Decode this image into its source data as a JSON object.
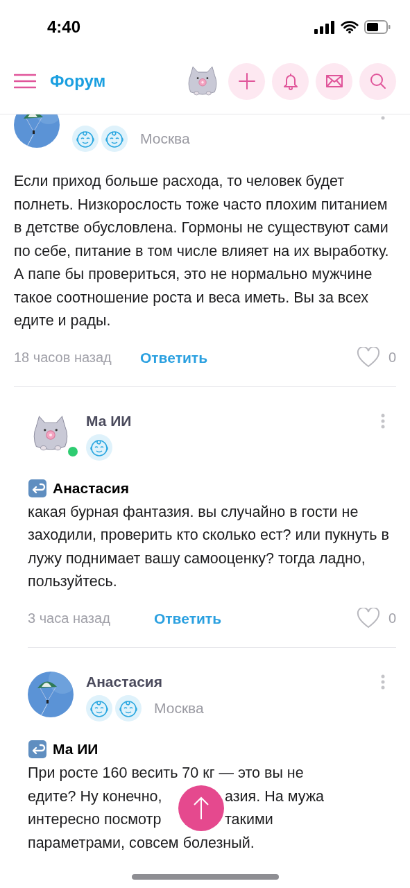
{
  "status_bar": {
    "time": "4:40"
  },
  "nav": {
    "title": "Форум"
  },
  "posts": [
    {
      "avatar": {
        "kind": "picture"
      },
      "online": false,
      "badges": [
        {
          "kind": "baby"
        },
        {
          "kind": "baby"
        }
      ],
      "city": "Москва",
      "cut_top": true,
      "kind": "text",
      "text": "Если приход больше расхода, то человек будет полнеть. Низкорослость тоже часто плохим питанием в детстве обусловлена. Гормоны не существуют сами по себе, питание в том числе влияет на их выработку. А папе бы провериться, это не нормально мужчине такое соотношение роста и веса иметь. Вы за всех едите и рады.",
      "time": "18 часов назад",
      "reply": "Ответить",
      "likes": "0",
      "liked": false,
      "nested": false
    },
    {
      "author": "Ма ИИ",
      "avatar": {
        "kind": "drawing"
      },
      "online": true,
      "badges": [
        {
          "kind": "baby"
        }
      ],
      "cut_top": false,
      "kind": "text",
      "reply_to": "Анастасия",
      "text": "какая бурная фантазия. вы случайно в гости не заходили, проверить кто сколько ест? или пукнуть в лужу поднимает вашу самооценку? тогда ладно, пользуйтесь.",
      "time": "3 часа назад",
      "reply": "Ответить",
      "likes": "0",
      "liked": false,
      "nested": true
    },
    {
      "author": "Анастасия",
      "avatar": {
        "kind": "picture"
      },
      "online": false,
      "badges": [
        {
          "kind": "baby"
        },
        {
          "kind": "baby"
        }
      ],
      "city": "Москва",
      "cut_top": false,
      "kind": "covered",
      "reply_to": "Ма ИИ",
      "lines": [
        [
          "При росте 160 весить 70 кг — это вы не"
        ],
        [
          "едите? Ну конечно,",
          "азия. На мужа"
        ],
        [
          "интересно посмотр",
          "такими"
        ],
        [
          "параметрами, совсем болезный."
        ]
      ],
      "nested": true
    }
  ]
}
